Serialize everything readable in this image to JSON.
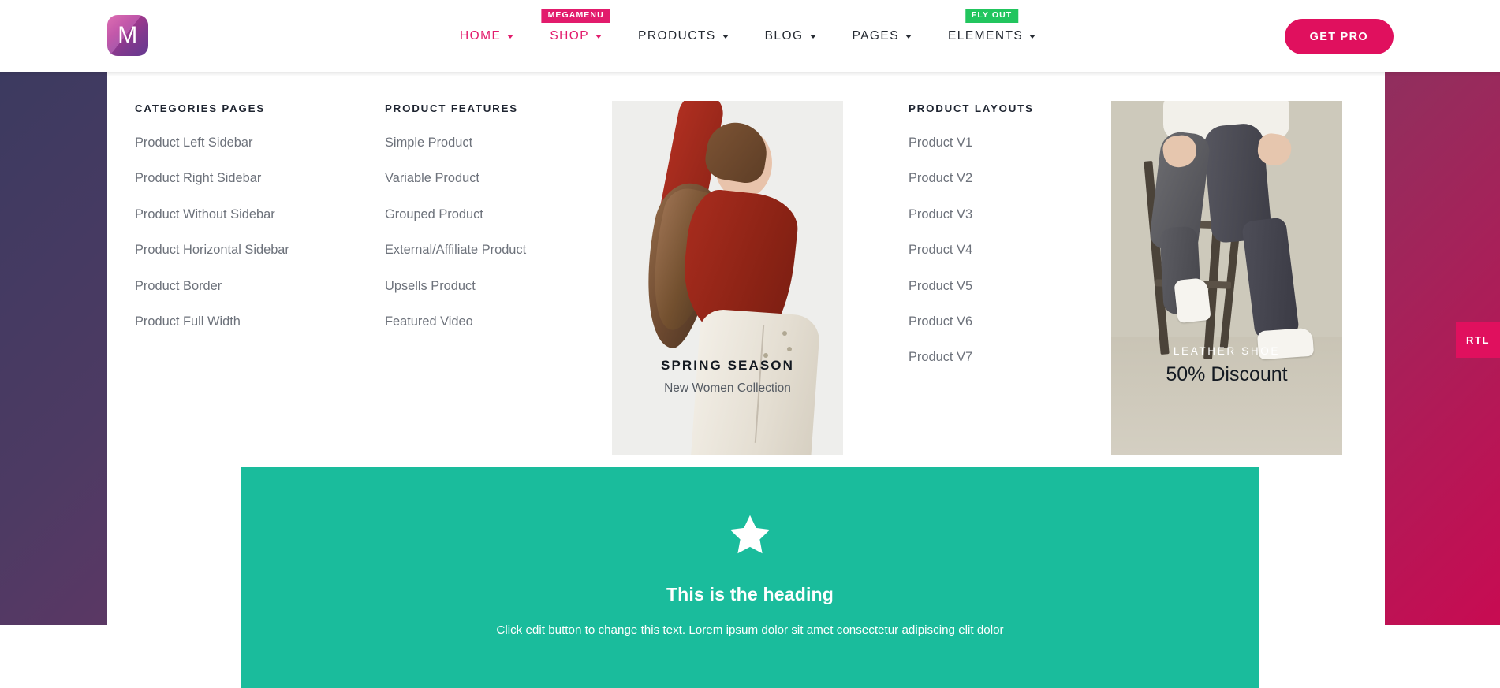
{
  "header": {
    "logo_letter": "M",
    "nav": [
      {
        "label": "HOME",
        "accent": true,
        "caret": true,
        "badge": null
      },
      {
        "label": "SHOP",
        "accent": true,
        "caret": true,
        "badge": {
          "text": "MEGAMENU",
          "color": "#e21b6c"
        }
      },
      {
        "label": "PRODUCTS",
        "accent": false,
        "caret": true,
        "badge": null
      },
      {
        "label": "BLOG",
        "accent": false,
        "caret": true,
        "badge": null
      },
      {
        "label": "PAGES",
        "accent": false,
        "caret": true,
        "badge": null
      },
      {
        "label": "ELEMENTS",
        "accent": false,
        "caret": true,
        "badge": {
          "text": "FLY OUT",
          "color": "#22c55e"
        }
      }
    ],
    "cta_label": "GET PRO"
  },
  "megamenu": {
    "columns": [
      {
        "heading": "CATEGORIES PAGES",
        "links": [
          "Product Left Sidebar",
          "Product Right Sidebar",
          "Product Without Sidebar",
          "Product Horizontal Sidebar",
          "Product Border",
          "Product Full Width"
        ]
      },
      {
        "heading": "PRODUCT FEATURES",
        "links": [
          "Simple Product",
          "Variable Product",
          "Grouped Product",
          "External/Affiliate Product",
          "Upsells Product",
          "Featured Video"
        ]
      },
      {
        "heading": "PRODUCT LAYOUTS",
        "links": [
          "Product V1",
          "Product V2",
          "Product V3",
          "Product V4",
          "Product V5",
          "Product V6",
          "Product V7"
        ]
      }
    ],
    "promos": [
      {
        "name": "spring-season",
        "kicker": "SPRING SEASON",
        "subtitle": "New Women Collection"
      },
      {
        "name": "leather-shoe",
        "kicker": "LEATHER SHOE",
        "subtitle": "50% Discount"
      }
    ]
  },
  "green_block": {
    "icon": "star-icon",
    "heading": "This is the heading",
    "text": "Click edit button to change this text. Lorem ipsum dolor sit amet consectetur adipiscing elit dolor",
    "color": "#1abc9c"
  },
  "side_tab": {
    "label": "RTL"
  },
  "colors": {
    "accent_pink": "#e21b6c",
    "cta_pink": "#e0105e",
    "badge_green": "#22c55e",
    "green_block": "#1abc9c",
    "nav_dark": "#252a32",
    "link_gray": "#6d727b"
  }
}
